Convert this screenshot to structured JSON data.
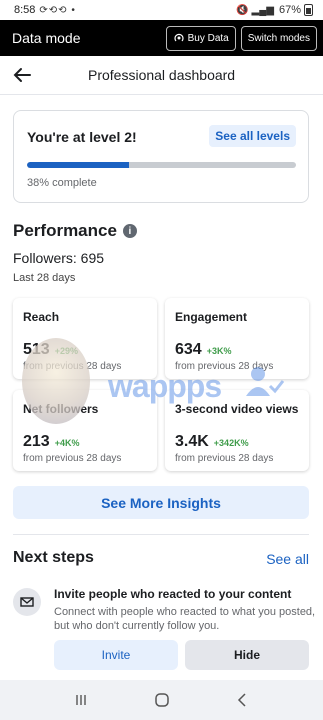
{
  "status_bar": {
    "time": "8:58",
    "left_icons": "⟳⟲⟲ •",
    "battery": "67%"
  },
  "data_mode": {
    "title": "Data mode",
    "buy_label": "Buy Data",
    "switch_label": "Switch modes"
  },
  "header": {
    "title": "Professional dashboard"
  },
  "level": {
    "title": "You're at level 2!",
    "see_all": "See all levels",
    "progress_fraction": 0.38,
    "progress_text": "38% complete"
  },
  "performance": {
    "title": "Performance",
    "followers": "Followers: 695",
    "period": "Last 28 days",
    "metrics": [
      {
        "name": "Reach",
        "value": "513",
        "change": "+29%",
        "note": "from previous 28 days"
      },
      {
        "name": "Engagement",
        "value": "634",
        "change": "+3K%",
        "note": "from previous 28 days"
      },
      {
        "name": "Net followers",
        "value": "213",
        "change": "+4K%",
        "note": "from previous 28 days"
      },
      {
        "name": "3-second video views",
        "value": "3.4K",
        "change": "+342K%",
        "note": "from previous 28 days"
      }
    ],
    "see_more": "See More Insights"
  },
  "next_steps": {
    "title": "Next steps",
    "see_all": "See all",
    "task_title": "Invite people who reacted to your content",
    "task_desc": "Connect with people who reacted to what you posted, but who don't currently follow you.",
    "invite_label": "Invite",
    "hide_label": "Hide"
  },
  "watermark": {
    "text": "wappps"
  },
  "colors": {
    "accent": "#1b62c2",
    "positive": "#3f9c4a"
  }
}
